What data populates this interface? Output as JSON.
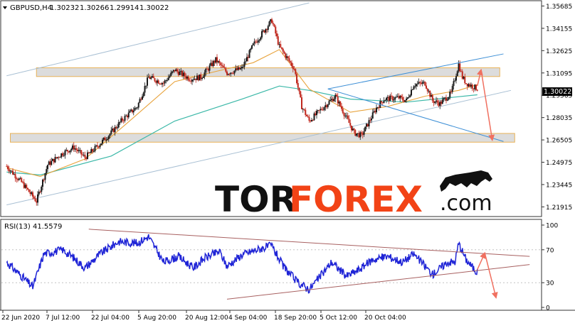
{
  "header": {
    "symbol_timeframe": "GBPUSD,H4",
    "open": "1.30232",
    "high": "1.30266",
    "low": "1.29914",
    "close": "1.30022"
  },
  "watermark": {
    "part1": "TOR",
    "part2": "FOREX",
    "suffix": ".com"
  },
  "colors": {
    "up_candle": "#1a1a1a",
    "down_candle": "#c0281e",
    "ma_fast": "#e8a33c",
    "ma_slow": "#3bb8a8",
    "channel": "#a9c0d4",
    "trendline": "#3d8fd6",
    "zone_fill": "#dcdcdc",
    "zone_border": "#e8b257",
    "arrow": "#f07060",
    "rsi_line": "#1f24d6",
    "rsi_trend": "#a86060",
    "price_tag_bg": "#000000",
    "price_tag_fg": "#ffffff",
    "wm_dark": "#111111",
    "wm_accent": "#f24316"
  },
  "chart_data": [
    {
      "type": "candlestick",
      "title": "GBPUSD,H4",
      "ylim": [
        1.2135,
        1.3595
      ],
      "y_ticks": [
        "1.35685",
        "1.34155",
        "1.32625",
        "1.31095",
        "1.29565",
        "1.28035",
        "1.26505",
        "1.24975",
        "1.23445",
        "1.21915"
      ],
      "current_price": "1.30022",
      "price_path": [
        [
          "2020-06-22",
          1.247
        ],
        [
          "2020-06-26",
          1.236
        ],
        [
          "2020-06-30",
          1.223
        ],
        [
          "2020-07-03",
          1.248
        ],
        [
          "2020-07-07",
          1.256
        ],
        [
          "2020-07-10",
          1.26
        ],
        [
          "2020-07-13",
          1.253
        ],
        [
          "2020-07-16",
          1.26
        ],
        [
          "2020-07-20",
          1.27
        ],
        [
          "2020-07-23",
          1.279
        ],
        [
          "2020-07-27",
          1.288
        ],
        [
          "2020-07-30",
          1.308
        ],
        [
          "2020-08-03",
          1.304
        ],
        [
          "2020-08-06",
          1.313
        ],
        [
          "2020-08-10",
          1.307
        ],
        [
          "2020-08-13",
          1.308
        ],
        [
          "2020-08-17",
          1.32
        ],
        [
          "2020-08-20",
          1.311
        ],
        [
          "2020-08-24",
          1.314
        ],
        [
          "2020-08-27",
          1.33
        ],
        [
          "2020-09-01",
          1.347
        ],
        [
          "2020-09-03",
          1.329
        ],
        [
          "2020-09-07",
          1.314
        ],
        [
          "2020-09-09",
          1.288
        ],
        [
          "2020-09-11",
          1.278
        ],
        [
          "2020-09-15",
          1.288
        ],
        [
          "2020-09-18",
          1.295
        ],
        [
          "2020-09-21",
          1.28
        ],
        [
          "2020-09-23",
          1.27
        ],
        [
          "2020-09-25",
          1.268
        ],
        [
          "2020-09-29",
          1.287
        ],
        [
          "2020-10-01",
          1.293
        ],
        [
          "2020-10-05",
          1.294
        ],
        [
          "2020-10-07",
          1.292
        ],
        [
          "2020-10-09",
          1.303
        ],
        [
          "2020-10-12",
          1.304
        ],
        [
          "2020-10-14",
          1.292
        ],
        [
          "2020-10-16",
          1.29
        ],
        [
          "2020-10-19",
          1.297
        ],
        [
          "2020-10-21",
          1.317
        ],
        [
          "2020-10-22",
          1.308
        ],
        [
          "2020-10-23",
          1.304
        ],
        [
          "2020-10-26",
          1.3002
        ]
      ],
      "ma_fast_path": [
        [
          "2020-06-22",
          1.246
        ],
        [
          "2020-07-01",
          1.24
        ],
        [
          "2020-07-13",
          1.252
        ],
        [
          "2020-07-24",
          1.276
        ],
        [
          "2020-08-06",
          1.305
        ],
        [
          "2020-08-17",
          1.312
        ],
        [
          "2020-08-27",
          1.318
        ],
        [
          "2020-09-03",
          1.327
        ],
        [
          "2020-09-11",
          1.3
        ],
        [
          "2020-09-22",
          1.284
        ],
        [
          "2020-10-02",
          1.288
        ],
        [
          "2020-10-12",
          1.295
        ],
        [
          "2020-10-21",
          1.299
        ],
        [
          "2020-10-26",
          1.303
        ]
      ],
      "ma_slow_path": [
        [
          "2020-06-22",
          1.243
        ],
        [
          "2020-07-01",
          1.241
        ],
        [
          "2020-07-20",
          1.254
        ],
        [
          "2020-08-06",
          1.278
        ],
        [
          "2020-08-24",
          1.293
        ],
        [
          "2020-09-03",
          1.302
        ],
        [
          "2020-09-11",
          1.299
        ],
        [
          "2020-09-22",
          1.293
        ],
        [
          "2020-10-07",
          1.291
        ],
        [
          "2020-10-26",
          1.296
        ]
      ],
      "channel_lines": [
        {
          "from": [
            "2020-06-22",
            1.309
          ],
          "to": [
            "2020-09-11",
            1.359
          ]
        },
        {
          "from": [
            "2020-06-22",
            1.2205
          ],
          "to": [
            "2020-11-04",
            1.299
          ]
        }
      ],
      "trend_lines": [
        {
          "from": [
            "2020-09-16",
            1.3
          ],
          "to": [
            "2020-11-02",
            1.264
          ]
        },
        {
          "from": [
            "2020-09-16",
            1.3
          ],
          "to": [
            "2020-11-02",
            1.324
          ]
        }
      ],
      "zones": [
        {
          "from": [
            "2020-06-30",
            1.3145
          ],
          "to": [
            "2020-11-01",
            1.3085
          ]
        },
        {
          "from": [
            "2020-06-23",
            1.2695
          ],
          "to": [
            "2020-11-05",
            1.2635
          ]
        }
      ],
      "forecast_arrows": [
        {
          "from": [
            "2020-10-26",
            1.302
          ],
          "to": [
            "2020-10-27",
            1.313
          ]
        },
        {
          "from": [
            "2020-10-27",
            1.313
          ],
          "to": [
            "2020-10-30",
            1.265
          ]
        }
      ]
    },
    {
      "type": "line",
      "title": "RSI(13) 41.5579",
      "ylim": [
        0,
        100
      ],
      "y_ticks": [
        "100",
        "70",
        "30",
        "0"
      ],
      "x_tick_labels": [
        "22 Jun 2020",
        "7 Jul 12:00",
        "22 Jul 04:00",
        "5 Aug 20:00",
        "20 Aug 12:00",
        "4 Sep 04:00",
        "18 Sep 20:00",
        "5 Oct 12:00",
        "20 Oct 04:00"
      ],
      "rsi_path": [
        [
          "2020-06-22",
          55
        ],
        [
          "2020-06-26",
          38
        ],
        [
          "2020-06-29",
          25
        ],
        [
          "2020-07-02",
          65
        ],
        [
          "2020-07-07",
          70
        ],
        [
          "2020-07-10",
          60
        ],
        [
          "2020-07-13",
          48
        ],
        [
          "2020-07-17",
          65
        ],
        [
          "2020-07-22",
          80
        ],
        [
          "2020-07-27",
          78
        ],
        [
          "2020-07-30",
          86
        ],
        [
          "2020-08-03",
          55
        ],
        [
          "2020-08-07",
          62
        ],
        [
          "2020-08-11",
          48
        ],
        [
          "2020-08-14",
          60
        ],
        [
          "2020-08-18",
          68
        ],
        [
          "2020-08-20",
          50
        ],
        [
          "2020-08-24",
          64
        ],
        [
          "2020-08-28",
          70
        ],
        [
          "2020-09-01",
          75
        ],
        [
          "2020-09-04",
          50
        ],
        [
          "2020-09-08",
          30
        ],
        [
          "2020-09-11",
          22
        ],
        [
          "2020-09-14",
          38
        ],
        [
          "2020-09-17",
          55
        ],
        [
          "2020-09-21",
          38
        ],
        [
          "2020-09-24",
          45
        ],
        [
          "2020-09-28",
          58
        ],
        [
          "2020-10-02",
          62
        ],
        [
          "2020-10-06",
          55
        ],
        [
          "2020-10-09",
          65
        ],
        [
          "2020-10-14",
          40
        ],
        [
          "2020-10-18",
          55
        ],
        [
          "2020-10-20",
          55
        ],
        [
          "2020-10-21",
          78
        ],
        [
          "2020-10-23",
          58
        ],
        [
          "2020-10-26",
          42
        ]
      ],
      "trend_lines": [
        {
          "from": [
            "2020-07-14",
            95
          ],
          "to": [
            "2020-11-09",
            62
          ]
        },
        {
          "from": [
            "2020-08-20",
            10
          ],
          "to": [
            "2020-11-09",
            52
          ]
        }
      ],
      "forecast_arrows": [
        {
          "from": [
            "2020-10-26",
            46
          ],
          "to": [
            "2020-10-28",
            66
          ]
        },
        {
          "from": [
            "2020-10-28",
            66
          ],
          "to": [
            "2020-10-31",
            12
          ]
        }
      ]
    }
  ]
}
